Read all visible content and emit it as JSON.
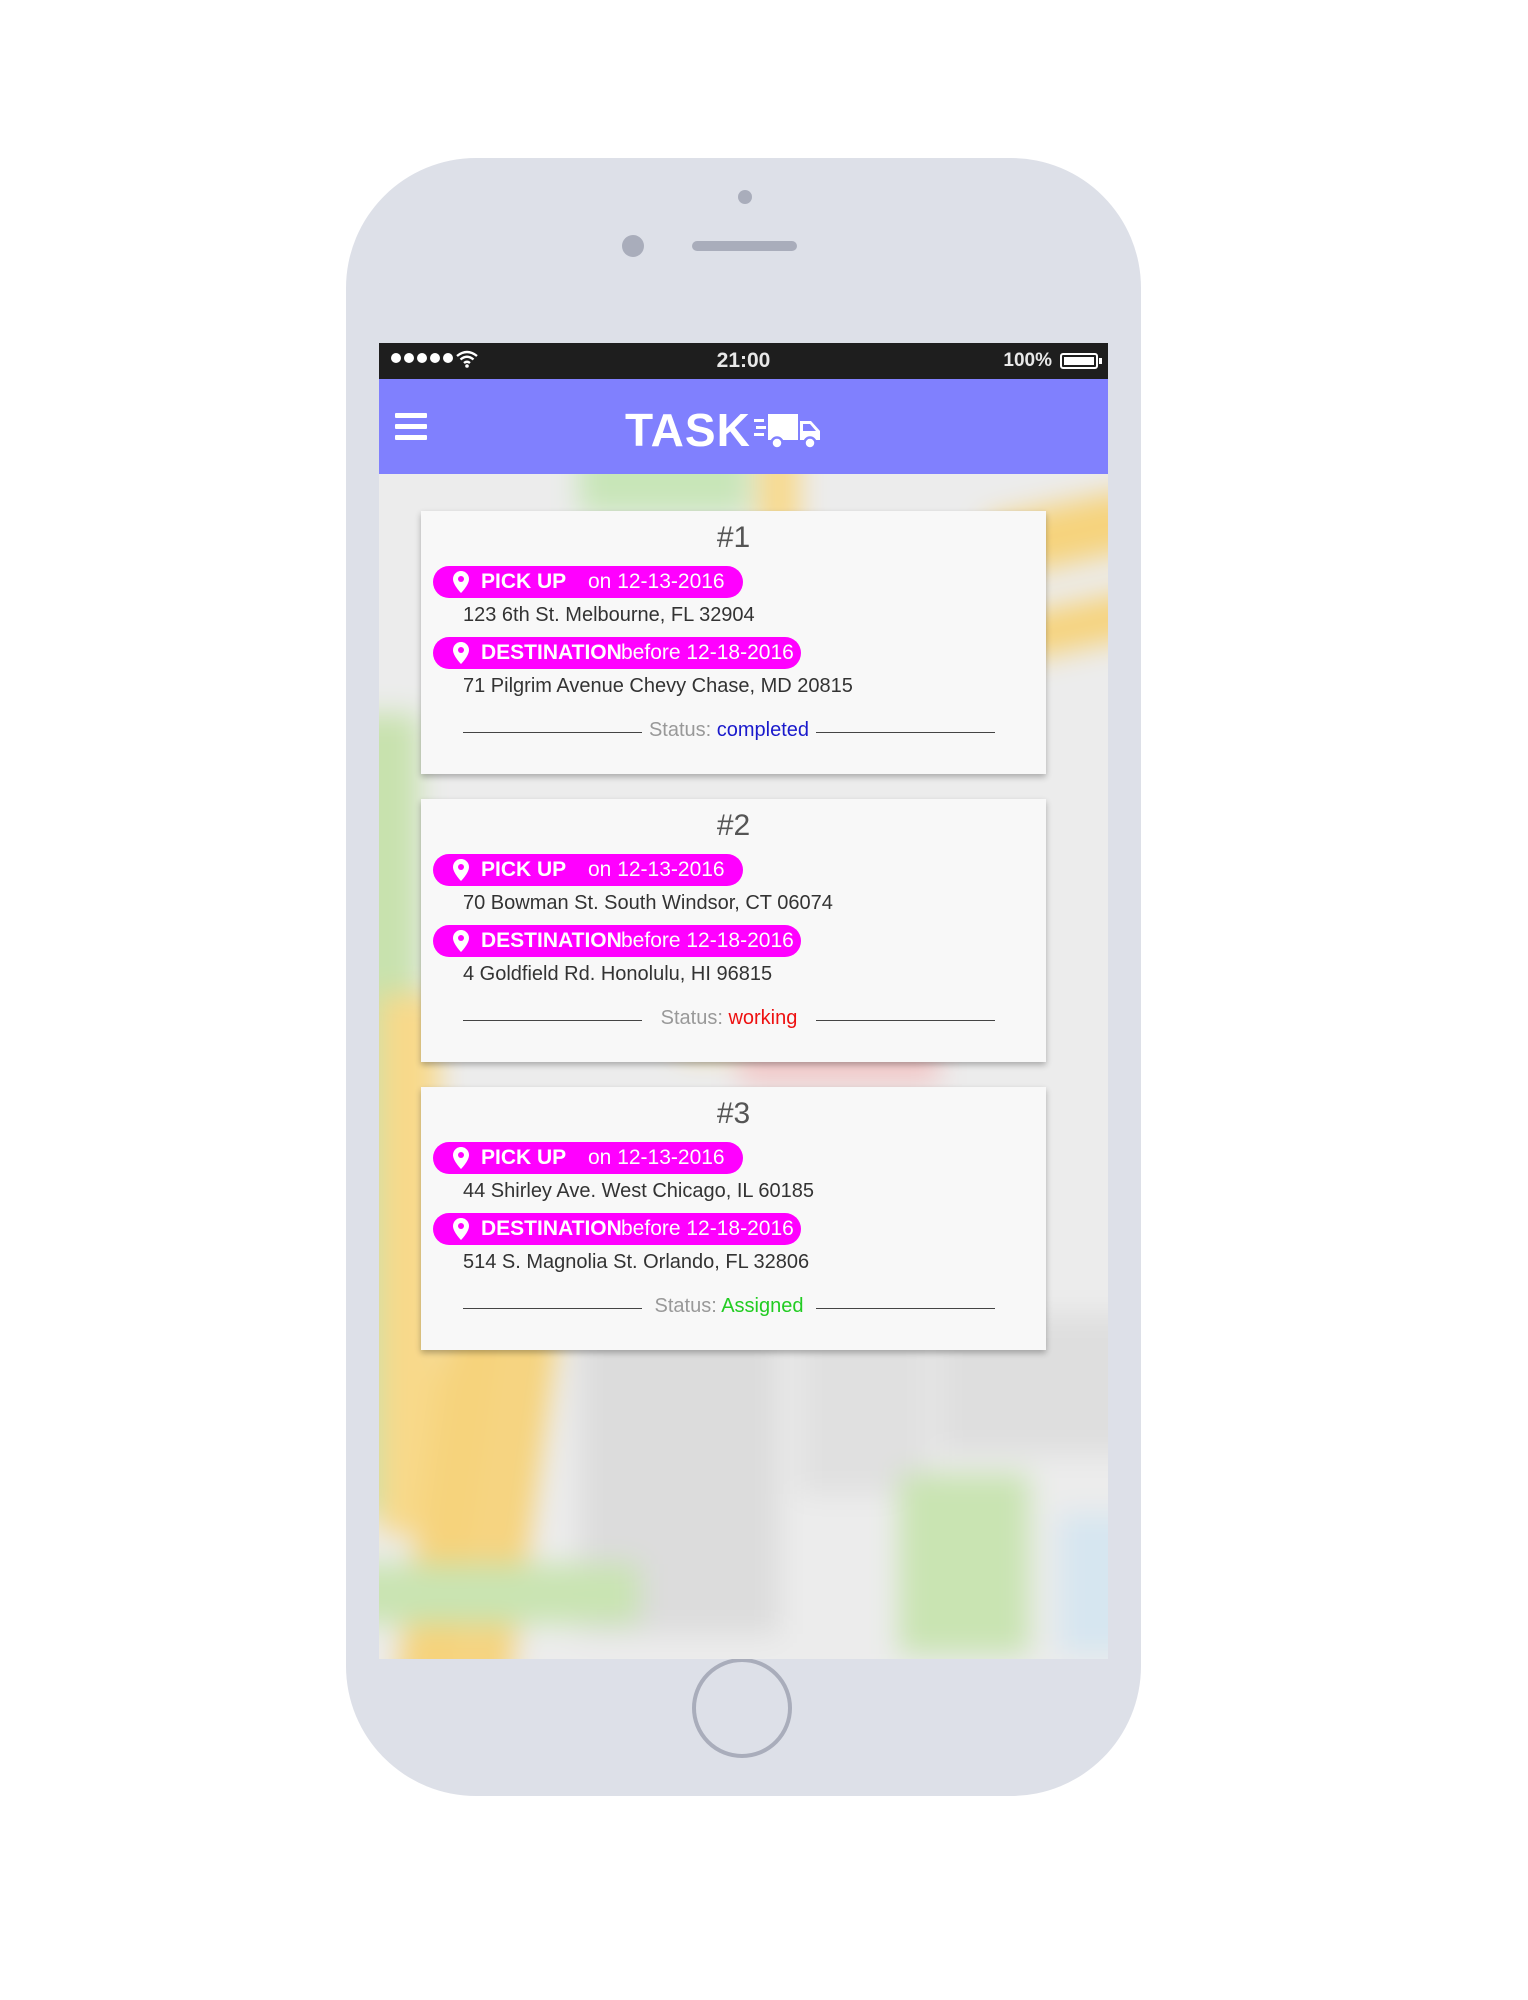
{
  "statusbar": {
    "time": "21:00",
    "battery": "100%",
    "signal_icon": "signal-dots-icon",
    "wifi_icon": "wifi-icon",
    "battery_icon": "battery-icon"
  },
  "appbar": {
    "title": "TASK",
    "menu_icon": "hamburger-menu-icon",
    "title_icon": "delivery-truck-icon",
    "color": "#8080fe"
  },
  "accent_color": "#ff00ff",
  "tasks": [
    {
      "number": "#1",
      "pickup_label": "PICK UP",
      "pickup_date": "on 12-13-2016",
      "pickup_address": "123 6th St. Melbourne, FL 32904",
      "destination_label": "DESTINATION",
      "destination_date": "before 12-18-2016",
      "destination_address": "71 Pilgrim Avenue Chevy Chase, MD 20815",
      "status_label": "Status:",
      "status_value": "completed",
      "status_color": "#1a1acc"
    },
    {
      "number": "#2",
      "pickup_label": "PICK UP",
      "pickup_date": "on 12-13-2016",
      "pickup_address": "70 Bowman St. South Windsor, CT 06074",
      "destination_label": "DESTINATION",
      "destination_date": "before 12-18-2016",
      "destination_address": "4 Goldfield Rd. Honolulu, HI 96815",
      "status_label": "Status:",
      "status_value": "working",
      "status_color": "#ee1111"
    },
    {
      "number": "#3",
      "pickup_label": "PICK UP",
      "pickup_date": "on 12-13-2016",
      "pickup_address": "44 Shirley Ave. West Chicago, IL 60185",
      "destination_label": "DESTINATION",
      "destination_date": "before 12-18-2016",
      "destination_address": "514 S. Magnolia St. Orlando, FL 32806",
      "status_label": "Status:",
      "status_value": "Assigned",
      "status_color": "#22cc22"
    }
  ]
}
